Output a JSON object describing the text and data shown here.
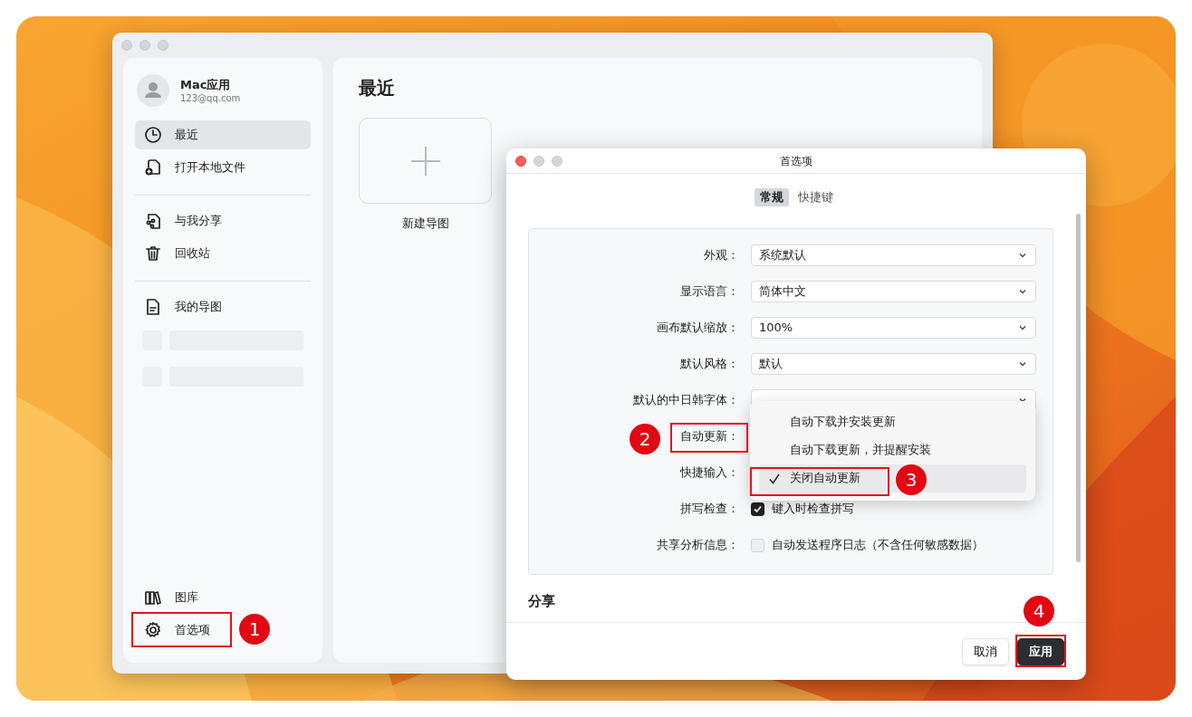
{
  "main_window": {
    "user": {
      "name": "Mac应用",
      "email": "123@qq.com"
    },
    "sidebar": {
      "groups": [
        [
          {
            "label": "最近",
            "kind": "clock",
            "selected": true
          },
          {
            "label": "打开本地文件",
            "kind": "file-plus",
            "selected": false
          }
        ],
        [
          {
            "label": "与我分享",
            "kind": "file-share",
            "selected": false
          },
          {
            "label": "回收站",
            "kind": "trash",
            "selected": false
          }
        ],
        [
          {
            "label": "我的导图",
            "kind": "document",
            "selected": false
          }
        ]
      ],
      "bottom_items": [
        {
          "label": "图库",
          "kind": "library",
          "selected": false
        },
        {
          "label": "首选项",
          "kind": "gear",
          "selected": false
        }
      ]
    },
    "content": {
      "title": "最近",
      "new_item": {
        "label": "新建导图"
      }
    }
  },
  "preferences": {
    "title": "首选项",
    "tabs": [
      {
        "label": "常规",
        "selected": true
      },
      {
        "label": "快捷键",
        "selected": false
      }
    ],
    "rows": [
      {
        "label": "外观：",
        "kind": "select",
        "value": "系统默认"
      },
      {
        "label": "显示语言：",
        "kind": "select",
        "value": "简体中文"
      },
      {
        "label": "画布默认缩放：",
        "kind": "select",
        "value": "100%"
      },
      {
        "label": "默认风格：",
        "kind": "select",
        "value": "默认"
      },
      {
        "label": "默认的中日韩字体：",
        "kind": "select"
      },
      {
        "label": "自动更新：",
        "kind": "label"
      },
      {
        "label": "快捷输入：",
        "kind": "label"
      },
      {
        "label": "拼写检查：",
        "kind": "checkbox",
        "text": "键入时检查拼写",
        "checked": true
      },
      {
        "label": "共享分析信息：",
        "kind": "checkbox",
        "text": "自动发送程序日志（不含任何敏感数据）",
        "checked": false
      }
    ],
    "dropdown": {
      "items": [
        {
          "label": "自动下载并安装更新",
          "selected": false
        },
        {
          "label": "自动下载更新，并提醒安装",
          "selected": false
        },
        {
          "label": "关闭自动更新",
          "selected": true
        }
      ]
    },
    "section_heading": "分享",
    "buttons": [
      {
        "label": "取消",
        "kind": "secondary"
      },
      {
        "label": "应用",
        "kind": "primary"
      }
    ]
  },
  "annotations": [
    {
      "number": "1"
    },
    {
      "number": "2"
    },
    {
      "number": "3"
    },
    {
      "number": "4"
    }
  ]
}
